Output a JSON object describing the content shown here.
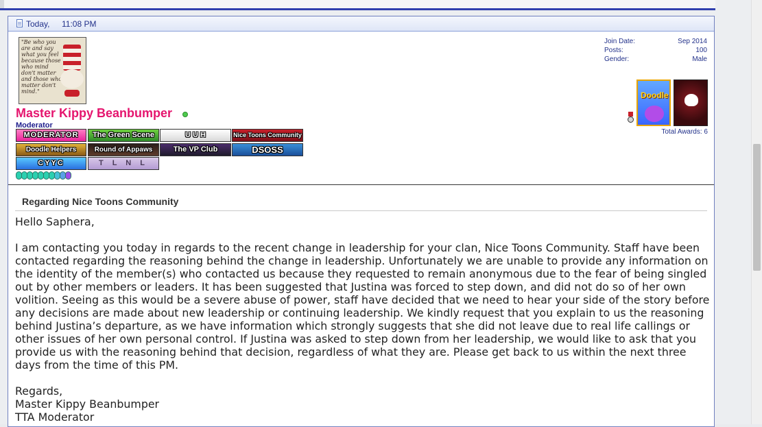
{
  "post": {
    "date": "Today,",
    "time": "11:08 PM"
  },
  "user": {
    "avatar_quote": "\"Be who you are and say what you feel because those who mind don't matter and those who matter don't mind.\"",
    "name": "Master Kippy Beanbumper",
    "title": "Moderator",
    "badges": [
      "MODERATOR",
      "The Green Scene",
      "U U H",
      "Nice Toons Community",
      "Doodle Helpers",
      "Round of Appaws",
      "The VP Club",
      "DSOSS",
      "CYYC",
      "T L N L"
    ],
    "gem_colors": [
      "#2bd0b0",
      "#2bd0b0",
      "#2bd0b0",
      "#2bd0b0",
      "#2bd0b0",
      "#2bd0b0",
      "#2bd0b0",
      "#45c0d8",
      "#5aa0e8",
      "#a04ce8"
    ],
    "stats": {
      "join_label": "Join Date:",
      "join_value": "Sep 2014",
      "posts_label": "Posts:",
      "posts_value": "100",
      "gender_label": "Gender:",
      "gender_value": "Male"
    },
    "award_doodle_text": "Doodle",
    "total_awards": "Total Awards: 6"
  },
  "message": {
    "title": "Regarding Nice Toons Community",
    "greeting": "Hello Saphera,",
    "body": "I am contacting you today in regards to the recent change in leadership for your clan, Nice Toons Community. Staff have been contacted regarding the reasoning behind the change in leadership. Unfortunately we are unable to provide any information on the identity of the member(s) who contacted us because they requested to remain anonymous due to the fear of being singled out by other members or leaders. It has been suggested that Justina was forced to step down, and did not do so of her own volition. Seeing as this would be a severe abuse of power, staff have decided that we need to hear your side of the story before any decisions are made about new leadership or continuing leadership. We kindly request that you explain to us the reasoning behind Justina’s departure, as we have information which strongly suggests that she did not leave due to real life callings or other issues of her own personal control. If Justina was asked to step down from her leadership, we would like to ask that you provide us with the reasoning behind that decision, regardless of what they are. Please get back to us within the next three days from the time of this PM.",
    "closing": "Regards,",
    "signature_name": "Master Kippy Beanbumper",
    "signature_role": "TTA Moderator"
  }
}
